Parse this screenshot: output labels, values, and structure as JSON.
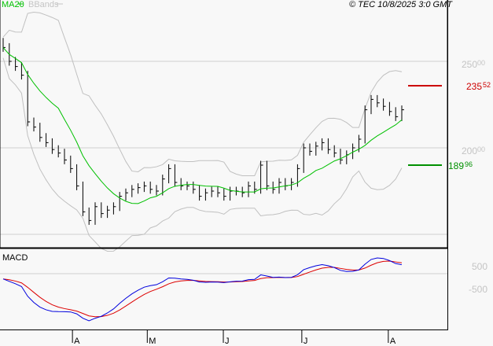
{
  "legend": {
    "ma_label": "MA20",
    "bb_label": "BBands"
  },
  "copyright": "© TEC 10/8/2025 3:0 GMT",
  "macd_label": "MACD",
  "colors": {
    "bars": "#000000",
    "ma": "#00c000",
    "bands": "#c0c0c0",
    "macd": "#0000dd",
    "signal": "#dd0000",
    "resistance": "#cc0000",
    "support": "#009000"
  },
  "chart_data": [
    {
      "type": "ohlc",
      "title": "",
      "ylim": [
        142,
        282
      ],
      "y_ticks": [
        {
          "value": 250,
          "int": "250",
          "dec": "00"
        },
        {
          "value": 200,
          "int": "200",
          "dec": "00"
        },
        {
          "value": 150,
          "int": "",
          "dec": ""
        }
      ],
      "closes": [
        258,
        250,
        247,
        242,
        215,
        212,
        206,
        203,
        199,
        197,
        193,
        188,
        178,
        163,
        158,
        166,
        162,
        164,
        166,
        172,
        174,
        176,
        177,
        178,
        176,
        175,
        182,
        188,
        180,
        178,
        178,
        176,
        172,
        174,
        175,
        174,
        172,
        175,
        175,
        174,
        178,
        176,
        190,
        178,
        176,
        180,
        178,
        180,
        188,
        200,
        198,
        201,
        203,
        199,
        197,
        193,
        196,
        200,
        205,
        222,
        228,
        226,
        224,
        221,
        218,
        222
      ],
      "ma_period": 10,
      "resistance": {
        "value": 235.52,
        "int": "235",
        "dec": "52"
      },
      "support": {
        "value": 189.96,
        "int": "189",
        "dec": "96"
      },
      "x_labels": [
        {
          "label": "A",
          "bar": 11.3
        },
        {
          "label": "M",
          "bar": 23.5
        },
        {
          "label": "J",
          "bar": 35.9
        },
        {
          "label": "J",
          "bar": 48.7
        },
        {
          "label": "A",
          "bar": 62.8
        }
      ]
    },
    {
      "type": "line",
      "title": "MACD",
      "y_ticks": [
        {
          "value": 500,
          "label": "500"
        },
        {
          "value": -500,
          "label": "-500"
        }
      ],
      "series": [
        "MACD",
        "Signal"
      ]
    }
  ]
}
